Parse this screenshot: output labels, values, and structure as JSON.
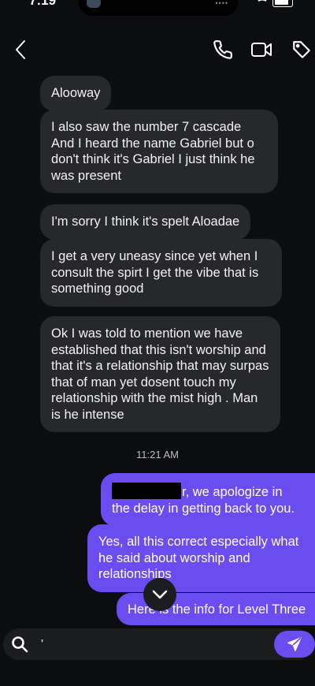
{
  "status_bar": {
    "time": "7:19"
  },
  "messages_incoming": [
    {
      "text": "Alooway"
    },
    {
      "text": "I also saw the number 7 cascade\nAnd I heard the name Gabriel but o don't think it's Gabriel I just think he was present"
    },
    {
      "text": "I'm sorry I think it's spelt Aloadae"
    },
    {
      "text": "I get a very uneasy since yet when I consult the spirt I get the vibe that is something good"
    },
    {
      "text": "Ok I was told to mention we have established that this isn't worship and that it's a relationship that may surpas that of man yet dosent touch my relationship with the mist high . Man is he intense"
    }
  ],
  "timestamp": "11:21 AM",
  "messages_outgoing": [
    {
      "text_after_redaction": "r, we apologize in the delay in getting back to you."
    },
    {
      "text": "Yes, all this correct especially what he said about worship and relationships"
    },
    {
      "text": "Here is the info for Level Three"
    }
  ],
  "compose": {
    "value": "'"
  },
  "colors": {
    "background": "#0c0d10",
    "incoming_bubble": "#27282c",
    "outgoing_bubble": "#6a4cf1"
  }
}
